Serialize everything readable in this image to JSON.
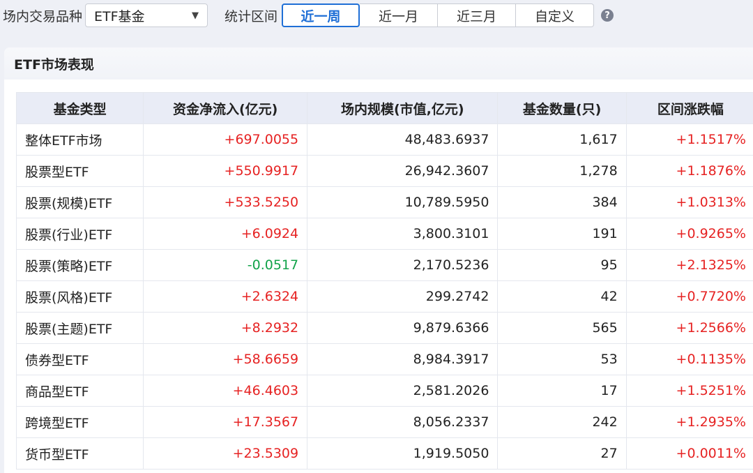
{
  "filter": {
    "category_label": "场内交易品种",
    "category_value": "ETF基金",
    "period_label": "统计区间",
    "period_options": [
      "近一周",
      "近一月",
      "近三月",
      "自定义"
    ],
    "active_period": "近一周",
    "help_symbol": "?"
  },
  "panel": {
    "title": "ETF市场表现"
  },
  "table": {
    "columns": [
      "基金类型",
      "资金净流入(亿元)",
      "场内规模(市值,亿元)",
      "基金数量(只)",
      "区间涨跌幅"
    ],
    "rows": [
      {
        "type": "整体ETF市场",
        "net_inflow": "+697.0055",
        "scale": "48,483.6937",
        "count": "1,617",
        "change": "+1.1517%"
      },
      {
        "type": "股票型ETF",
        "net_inflow": "+550.9917",
        "scale": "26,942.3607",
        "count": "1,278",
        "change": "+1.1876%"
      },
      {
        "type": "股票(规模)ETF",
        "net_inflow": "+533.5250",
        "scale": "10,789.5950",
        "count": "384",
        "change": "+1.0313%"
      },
      {
        "type": "股票(行业)ETF",
        "net_inflow": "+6.0924",
        "scale": "3,800.3101",
        "count": "191",
        "change": "+0.9265%"
      },
      {
        "type": "股票(策略)ETF",
        "net_inflow": "-0.0517",
        "scale": "2,170.5236",
        "count": "95",
        "change": "+2.1325%"
      },
      {
        "type": "股票(风格)ETF",
        "net_inflow": "+2.6324",
        "scale": "299.2742",
        "count": "42",
        "change": "+0.7720%"
      },
      {
        "type": "股票(主题)ETF",
        "net_inflow": "+8.2932",
        "scale": "9,879.6366",
        "count": "565",
        "change": "+1.2566%"
      },
      {
        "type": "债券型ETF",
        "net_inflow": "+58.6659",
        "scale": "8,984.3917",
        "count": "53",
        "change": "+0.1135%"
      },
      {
        "type": "商品型ETF",
        "net_inflow": "+46.4603",
        "scale": "2,581.2026",
        "count": "17",
        "change": "+1.5251%"
      },
      {
        "type": "跨境型ETF",
        "net_inflow": "+17.3567",
        "scale": "8,056.2337",
        "count": "242",
        "change": "+1.2935%"
      },
      {
        "type": "货币型ETF",
        "net_inflow": "+23.5309",
        "scale": "1,919.5050",
        "count": "27",
        "change": "+0.0011%"
      }
    ]
  },
  "colors": {
    "up": "#e62222",
    "down": "#12a34a",
    "accent": "#1f6fd6"
  }
}
